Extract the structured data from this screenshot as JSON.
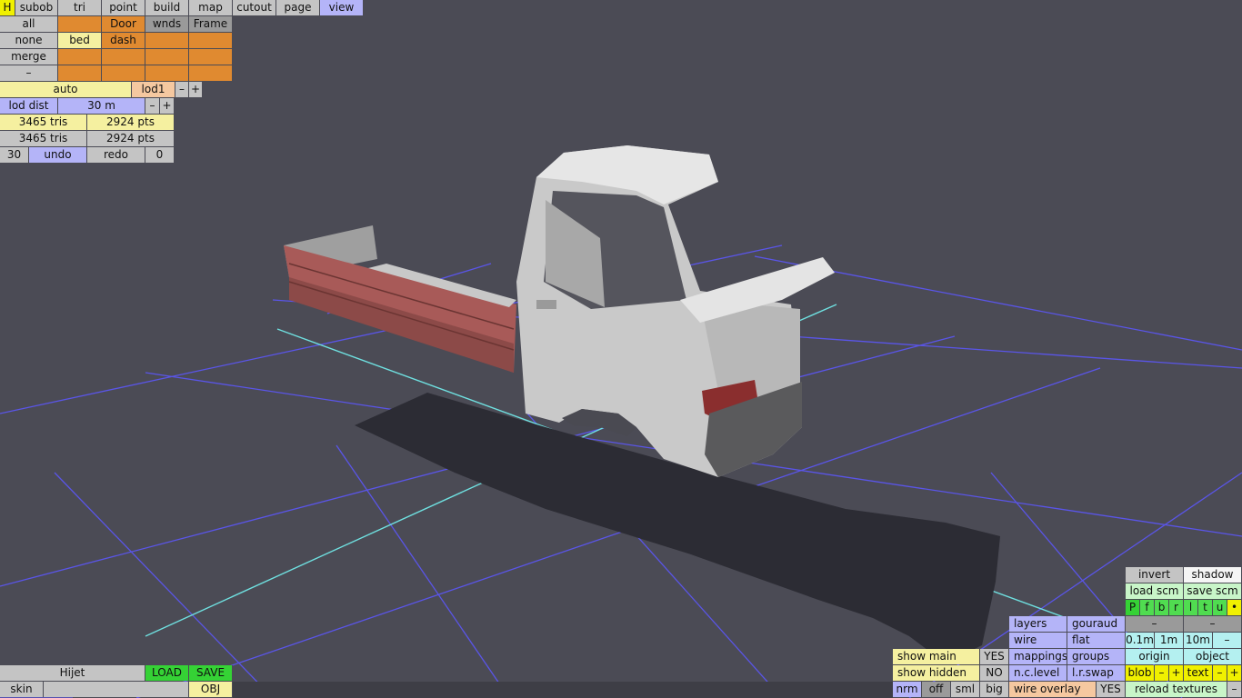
{
  "top_menu": {
    "h": "H",
    "tabs": [
      "subob",
      "tri",
      "point",
      "build",
      "map",
      "cutout",
      "page",
      "view"
    ]
  },
  "subobj": {
    "all": "all",
    "none": "none",
    "merge": "merge",
    "dash_btn": "–",
    "row1": [
      "",
      "Door",
      "wnds",
      "Frame"
    ],
    "row2": [
      "bed",
      "dash",
      "",
      ""
    ],
    "row3": [
      "",
      "",
      "",
      ""
    ],
    "row4": [
      "",
      "",
      "",
      ""
    ]
  },
  "lod": {
    "auto": "auto",
    "lod": "lod1",
    "minus": "–",
    "plus": "+",
    "dist_label": "lod dist",
    "dist_value": "30 m",
    "dist_minus": "–",
    "dist_plus": "+"
  },
  "stats": {
    "tris1": "3465 tris",
    "pts1": "2924 pts",
    "tris2": "3465 tris",
    "pts2": "2924 pts"
  },
  "history": {
    "count": "30",
    "undo": "undo",
    "redo": "redo",
    "redo_count": "0"
  },
  "file": {
    "name": "Hijet",
    "load": "LOAD",
    "save": "SAVE",
    "skin": "skin",
    "skin_value": "",
    "obj": "OBJ"
  },
  "right_panel": {
    "invert": "invert",
    "shadow": "shadow",
    "load_scm": "load scm",
    "save_scm": "save scm",
    "views": [
      "P",
      "f",
      "b",
      "r",
      "l",
      "t",
      "u",
      "•"
    ],
    "minus_a": "–",
    "minus_b": "–",
    "grid": [
      "0.1m",
      "1m",
      "10m",
      "–"
    ],
    "origin": "origin",
    "object": "object",
    "blob": "blob",
    "blob_minus": "–",
    "blob_plus": "+",
    "text": "text",
    "text_minus": "–",
    "text_plus": "+",
    "reload": "reload textures",
    "reload_minus": "–"
  },
  "render_panel": {
    "layers": "layers",
    "gouraud": "gouraud",
    "wire": "wire",
    "flat": "flat",
    "mappings": "mappings",
    "groups": "groups",
    "nclevel": "n.c.level",
    "lrswap": "l.r.swap",
    "wire_overlay": "wire overlay",
    "wire_overlay_val": "YES"
  },
  "show_panel": {
    "show_main": "show main",
    "show_main_val": "YES",
    "show_hidden": "show hidden",
    "show_hidden_val": "NO",
    "modes": [
      "nrm",
      "off",
      "sml",
      "big"
    ]
  },
  "colors": {
    "background": "#4b4b55",
    "grid_blue": "#5050f0",
    "grid_cyan": "#60e0e0",
    "orange": "#e08a30",
    "green": "#35d235"
  }
}
